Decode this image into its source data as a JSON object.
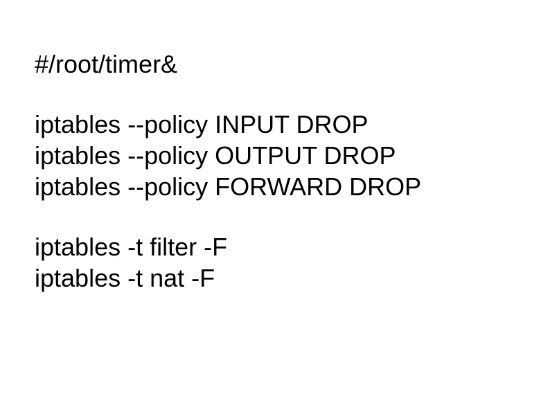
{
  "blocks": {
    "block1": {
      "line1": "#/root/timer&"
    },
    "block2": {
      "line1": "iptables --policy INPUT DROP",
      "line2": "iptables --policy OUTPUT DROP",
      "line3": "iptables --policy FORWARD DROP"
    },
    "block3": {
      "line1": "iptables -t filter -F",
      "line2": "iptables -t nat -F"
    }
  }
}
